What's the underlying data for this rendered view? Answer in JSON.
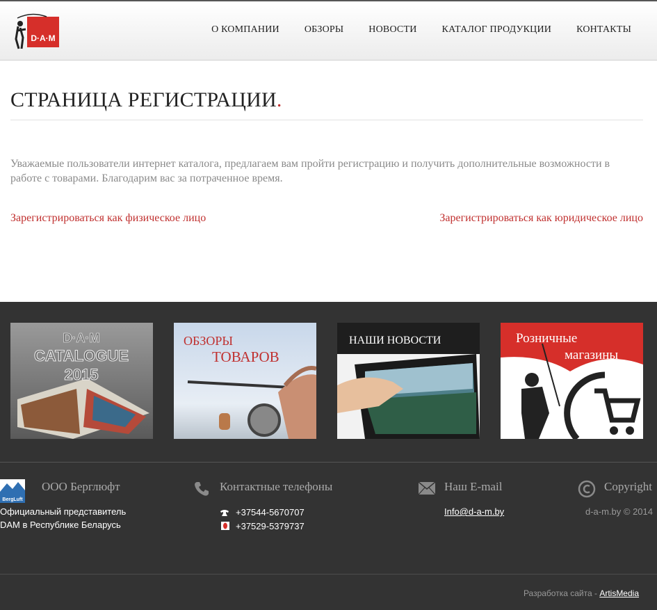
{
  "header": {
    "logo_text": "D·A·M",
    "nav": [
      {
        "label": "О КОМПАНИИ"
      },
      {
        "label": "ОБЗОРЫ"
      },
      {
        "label": "НОВОСТИ"
      },
      {
        "label": "КАТАЛОГ ПРОДУКЦИИ"
      },
      {
        "label": "КОНТАКТЫ"
      }
    ]
  },
  "main": {
    "title": "СТРАНИЦА РЕГИСТРАЦИИ",
    "title_dot": ".",
    "intro": "Уважаемые пользователи интернет каталога, предлагаем вам пройти регистрацию и получить дополнительные возможности в работе с товарами. Благодарим вас за потраченное время.",
    "register_individual": "Зарегистрироваться как физическое лицо",
    "register_legal": "Зарегистрироваться как юридическое лицо"
  },
  "tiles": {
    "catalogue": {
      "line1": "D·A·M",
      "line2": "CATALOGUE",
      "line3": "2015"
    },
    "reviews": {
      "line1": "ОБЗОРЫ",
      "line2": "ТОВАРОВ"
    },
    "news": {
      "label": "НАШИ НОВОСТИ"
    },
    "shops": {
      "line1": "Розничные",
      "line2": "магазины"
    }
  },
  "footer": {
    "company": {
      "logo_text": "BergLuft",
      "heading": "ООО Берглюфт",
      "line1": "Официальный представитель",
      "line2": "DAM в Республике Беларусь"
    },
    "phones": {
      "heading": "Контактные телефоны",
      "phone1": "+37544-5670707",
      "phone2": "+37529-5379737"
    },
    "email": {
      "heading": "Наш E-mail",
      "address": "Info@d-a-m.by"
    },
    "copyright": {
      "heading": "Copyright",
      "text": "d-a-m.by © 2014"
    },
    "developer": {
      "prefix": "Разработка сайта - ",
      "link": "ArtisMedia"
    }
  },
  "colors": {
    "accent": "#c0302f",
    "footer_bg": "#333333",
    "muted_text": "#8a8a8a"
  }
}
